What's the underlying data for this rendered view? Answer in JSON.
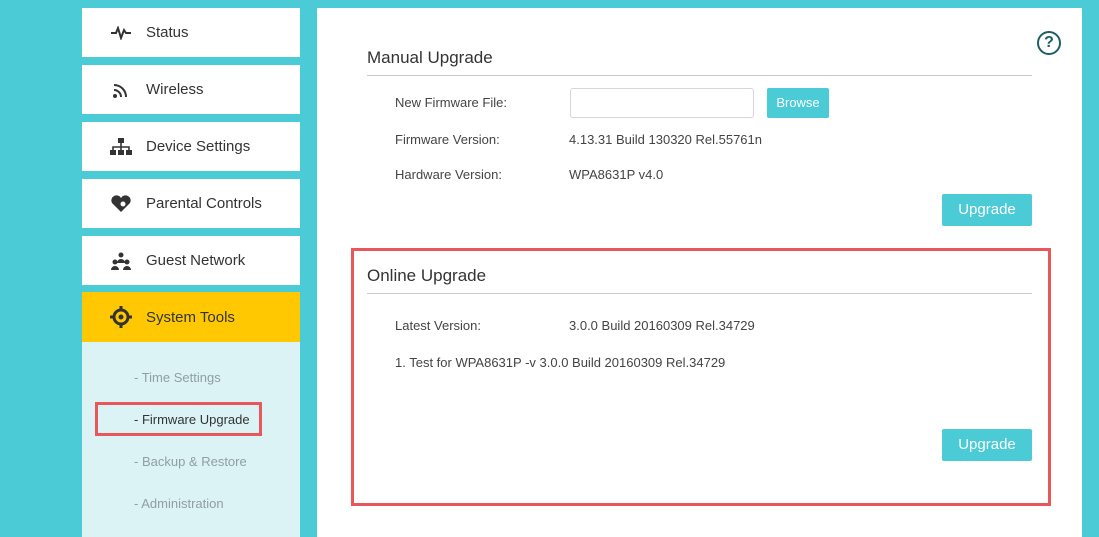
{
  "sidebar": {
    "items": [
      {
        "label": "Status",
        "icon": "pulse-icon"
      },
      {
        "label": "Wireless",
        "icon": "wifi-icon"
      },
      {
        "label": "Device Settings",
        "icon": "network-icon"
      },
      {
        "label": "Parental Controls",
        "icon": "heart-icon"
      },
      {
        "label": "Guest Network",
        "icon": "guests-icon"
      },
      {
        "label": "System Tools",
        "icon": "gear-icon"
      }
    ],
    "submenu": [
      {
        "label": "- Time Settings"
      },
      {
        "label": "- Firmware Upgrade"
      },
      {
        "label": "- Backup & Restore"
      },
      {
        "label": "- Administration"
      }
    ]
  },
  "manual": {
    "title": "Manual Upgrade",
    "file_label": "New Firmware File:",
    "file_value": "",
    "browse_label": "Browse",
    "fw_label": "Firmware Version:",
    "fw_value": "4.13.31 Build 130320 Rel.55761n",
    "hw_label": "Hardware Version:",
    "hw_value": "WPA8631P v4.0",
    "upgrade_label": "Upgrade"
  },
  "online": {
    "title": "Online Upgrade",
    "latest_label": "Latest Version:",
    "latest_value": "3.0.0 Build 20160309 Rel.34729",
    "note": "1. Test for WPA8631P -v 3.0.0 Build 20160309 Rel.34729",
    "upgrade_label": "Upgrade"
  },
  "help_icon": "?",
  "colors": {
    "accent": "#4acbd6",
    "active": "#ffc800",
    "highlight": "#e9575a"
  }
}
